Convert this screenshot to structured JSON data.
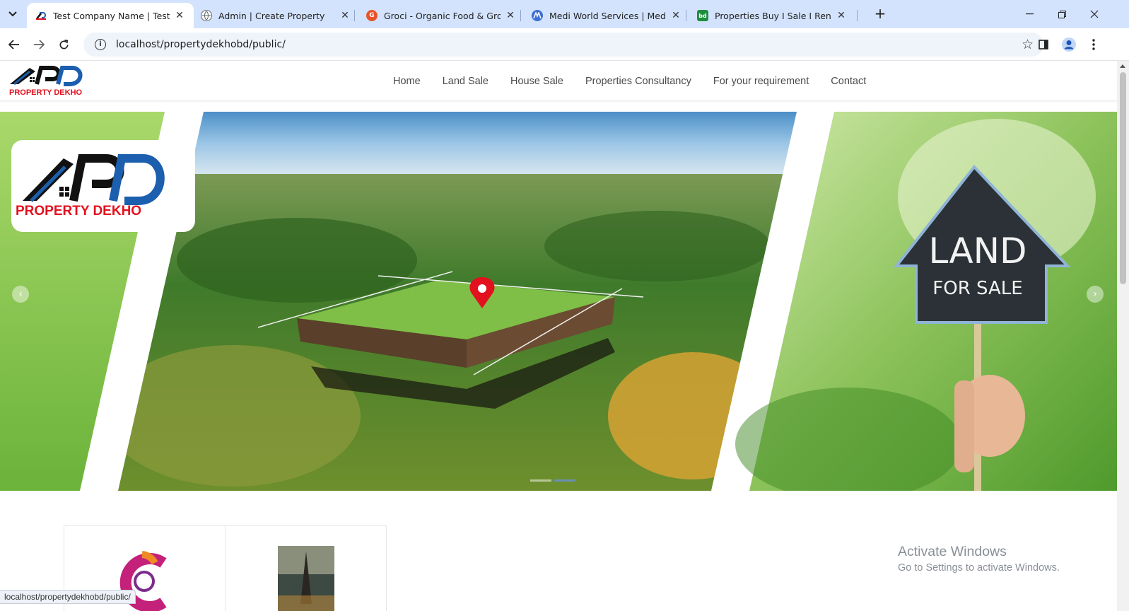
{
  "browser": {
    "tabs": [
      {
        "title": "Test Company Name | Test Com",
        "favicon_color": "#1a73e8",
        "active": true
      },
      {
        "title": "Admin | Create Property",
        "favicon_color": "#5f6368",
        "active": false
      },
      {
        "title": "Groci - Organic Food & Grocery",
        "favicon_color": "#e8542a",
        "active": false
      },
      {
        "title": "Medi World Services | Medical E",
        "favicon_color": "#3c6fd1",
        "active": false
      },
      {
        "title": "Properties Buy I Sale I Rent - Re",
        "favicon_color": "#1e8e3e",
        "active": false
      }
    ],
    "favicon_letters": {
      "groci": "G",
      "bd": "bd"
    },
    "new_tab": "+",
    "url": "localhost/propertydekhobd/public/",
    "status_url": "localhost/propertydekhobd/public/"
  },
  "site": {
    "logo_text": "PROPERTY DEKHO",
    "logo_mark": "PD",
    "nav": [
      "Home",
      "Land Sale",
      "House Sale",
      "Properties Consultancy",
      "For your requirement",
      "Contact"
    ]
  },
  "hero": {
    "sign_title": "LAND",
    "sign_subtitle": "FOR SALE",
    "prev_icon": "‹",
    "next_icon": "›",
    "slides": 2,
    "active_slide": 2
  },
  "windows_watermark": {
    "heading": "Activate Windows",
    "sub": "Go to Settings to activate Windows."
  },
  "colors": {
    "brand_red": "#e3101e",
    "brand_blue": "#1b5fae",
    "chrome_tabbar": "#d3e3fd"
  }
}
